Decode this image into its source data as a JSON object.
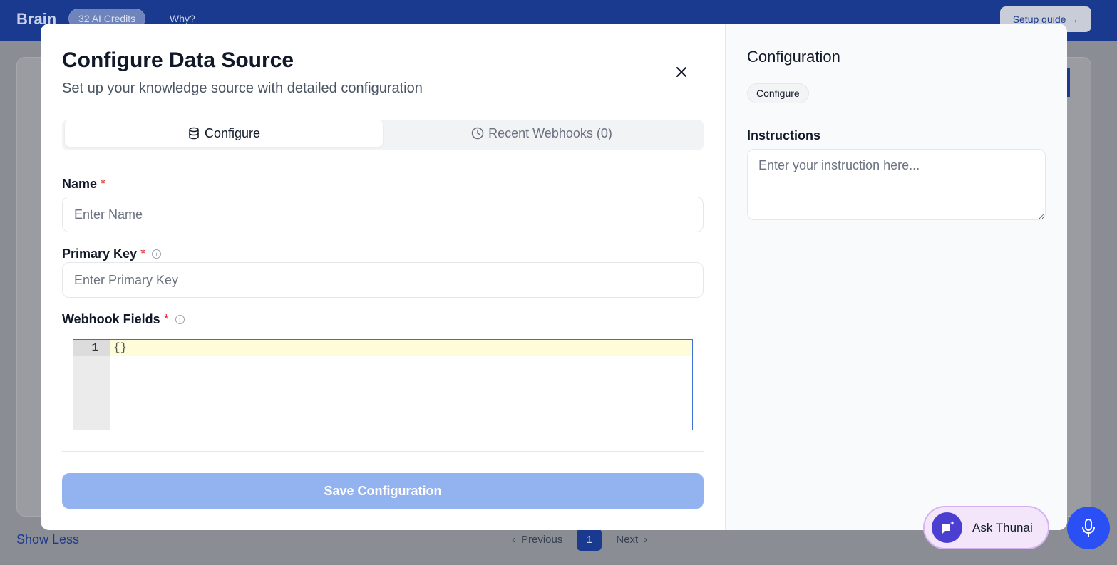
{
  "app": {
    "brand": "Brain",
    "credits": "32 AI Credits",
    "why": "Why?",
    "setup_guide": "Setup guide →"
  },
  "footer": {
    "show_less": "Show Less",
    "previous": "Previous",
    "next": "Next",
    "current_page": "1"
  },
  "modal": {
    "title": "Configure Data Source",
    "subtitle": "Set up your knowledge source with detailed configuration",
    "tabs": [
      {
        "label": "Configure",
        "icon": "database-icon",
        "active": true
      },
      {
        "label": "Recent Webhooks (0)",
        "icon": "clock-icon",
        "active": false
      }
    ],
    "fields": {
      "name": {
        "label": "Name",
        "required": "*",
        "placeholder": "Enter Name",
        "value": ""
      },
      "primary_key": {
        "label": "Primary Key",
        "required": "*",
        "placeholder": "Enter Primary Key",
        "value": ""
      },
      "webhook_fields": {
        "label": "Webhook Fields",
        "required": "*",
        "line_number": "1",
        "code": "{}"
      }
    },
    "save_label": "Save Configuration"
  },
  "right_panel": {
    "title": "Configuration",
    "chip": "Configure",
    "instructions_label": "Instructions",
    "instructions_placeholder": "Enter your instruction here..."
  },
  "floating": {
    "ask_label": "Ask Thunai"
  },
  "colors": {
    "primary": "#1a3a8f",
    "save_disabled": "#93b3f0",
    "required": "#dc2626",
    "mic": "#2a4ff5"
  }
}
